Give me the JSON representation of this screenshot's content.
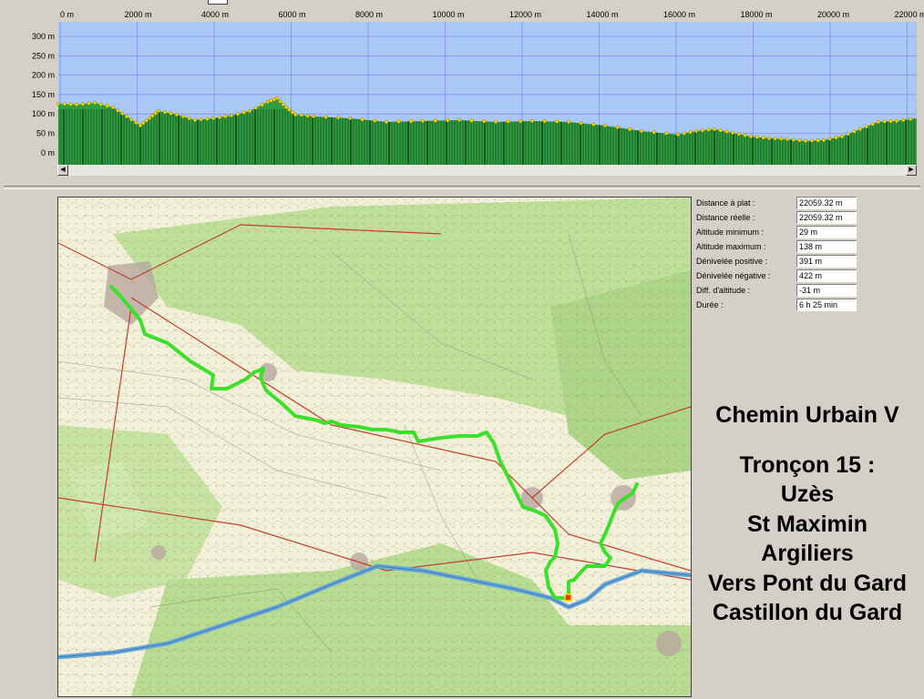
{
  "profile": {
    "x_labels": [
      "0 m",
      "2000 m",
      "4000 m",
      "6000 m",
      "8000 m",
      "10000 m",
      "12000 m",
      "14000 m",
      "16000 m",
      "18000 m",
      "20000 m",
      "22000 m"
    ],
    "y_labels": [
      "300 m",
      "250 m",
      "200 m",
      "150 m",
      "100 m",
      "50 m",
      "0 m"
    ],
    "colors": {
      "sky": "#a9c8f5",
      "terrain": "#2e9e3e",
      "terrain_dark": "#0a2a10",
      "points": "#f0e000",
      "grid": "#7a7af0"
    }
  },
  "stats": {
    "rows": [
      {
        "label": "Distance à plat :",
        "value": "22059.32 m"
      },
      {
        "label": "Distance réelle :",
        "value": "22059.32 m"
      },
      {
        "label": "Altitude minimum :",
        "value": "29 m"
      },
      {
        "label": "Altitude maximum :",
        "value": "138 m"
      },
      {
        "label": "Dénivelée positive :",
        "value": "391 m"
      },
      {
        "label": "Dénivelée négative :",
        "value": "422 m"
      },
      {
        "label": "Diff. d'altitude :",
        "value": "-31 m"
      },
      {
        "label": "Durée :",
        "value": "6 h 25 min"
      }
    ]
  },
  "title": {
    "line1": "Chemin Urbain V",
    "line2": "Tronçon 15 :",
    "line3": "Uzès",
    "line4": "St Maximin",
    "line5": "Argiliers",
    "line6": "Vers Pont du Gard",
    "line7": "Castillon du Gard"
  },
  "map": {
    "colors": {
      "land": "#f2f0d8",
      "forest": "#bfe09a",
      "river": "#6aa8d8",
      "track": "#3ae02a",
      "road": "#c04030"
    }
  },
  "scrollbar": {
    "left_arrow": "◀",
    "right_arrow": "▶"
  }
}
